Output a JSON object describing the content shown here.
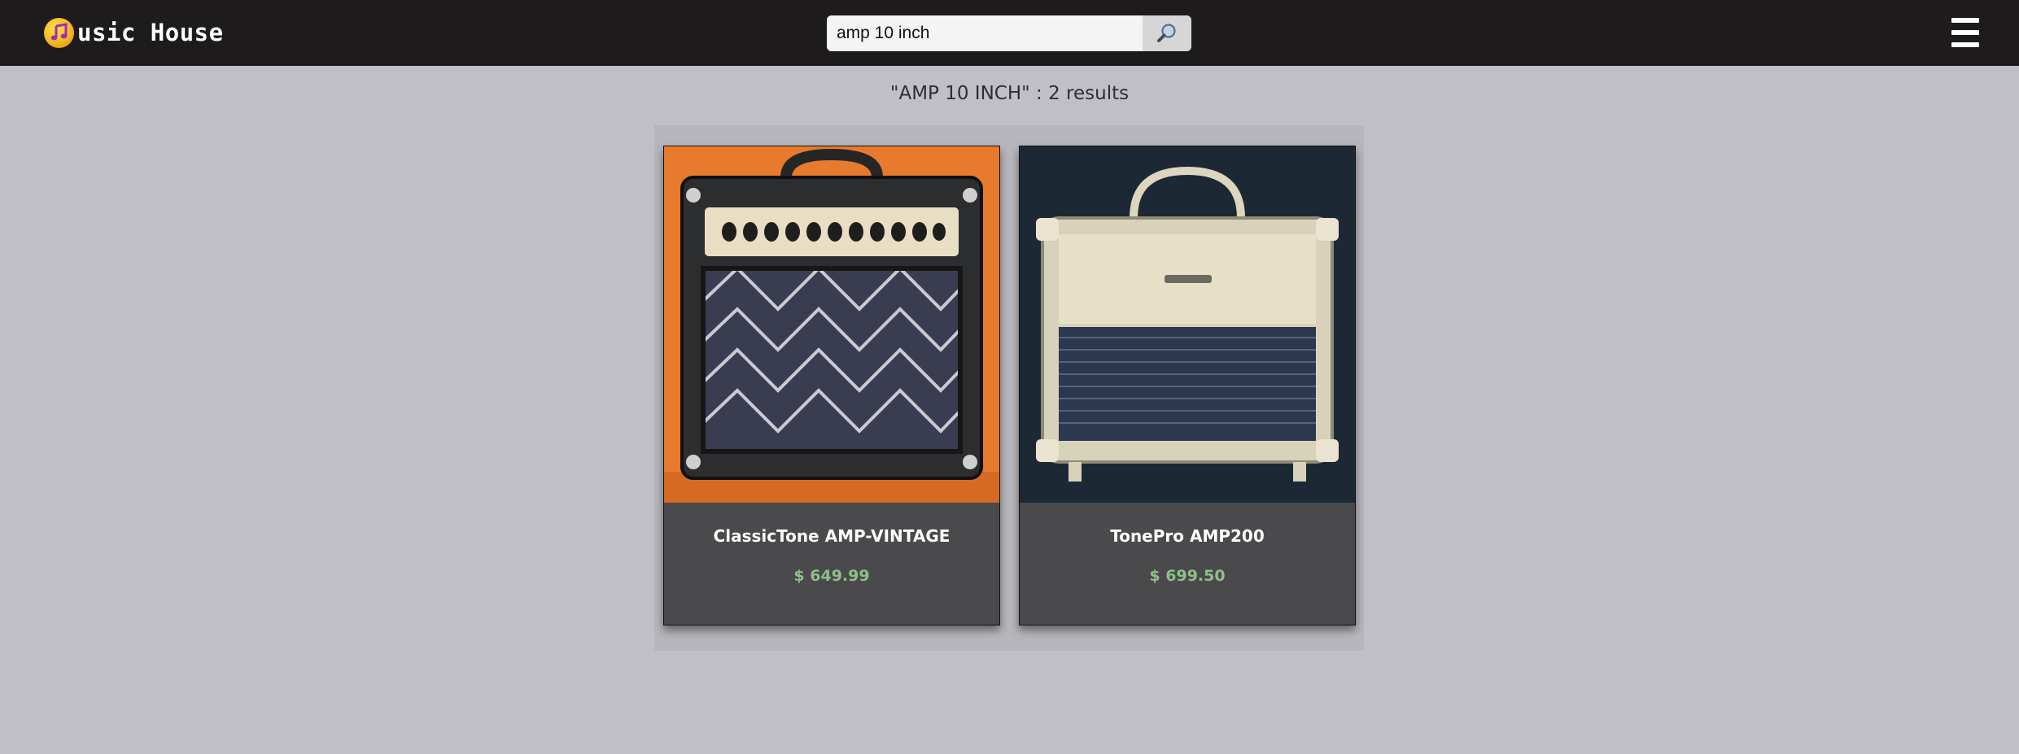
{
  "header": {
    "brand_text": "usic House",
    "logo_icon": "music-note-icon",
    "search": {
      "value": "amp 10 inch",
      "button_icon": "magnifier-icon"
    },
    "menu_icon": "hamburger-menu-icon"
  },
  "results": {
    "heading": "\"AMP 10 INCH\" : 2 results",
    "items": [
      {
        "title": "ClassicTone AMP-VINTAGE",
        "price": "$ 649.99"
      },
      {
        "title": "TonePro AMP200",
        "price": "$ 699.50"
      }
    ]
  },
  "colors": {
    "header_bg": "#1d1b1c",
    "page_bg": "#c0bfc7",
    "card_bg": "#4a4a4d",
    "price": "#8fbf88"
  }
}
